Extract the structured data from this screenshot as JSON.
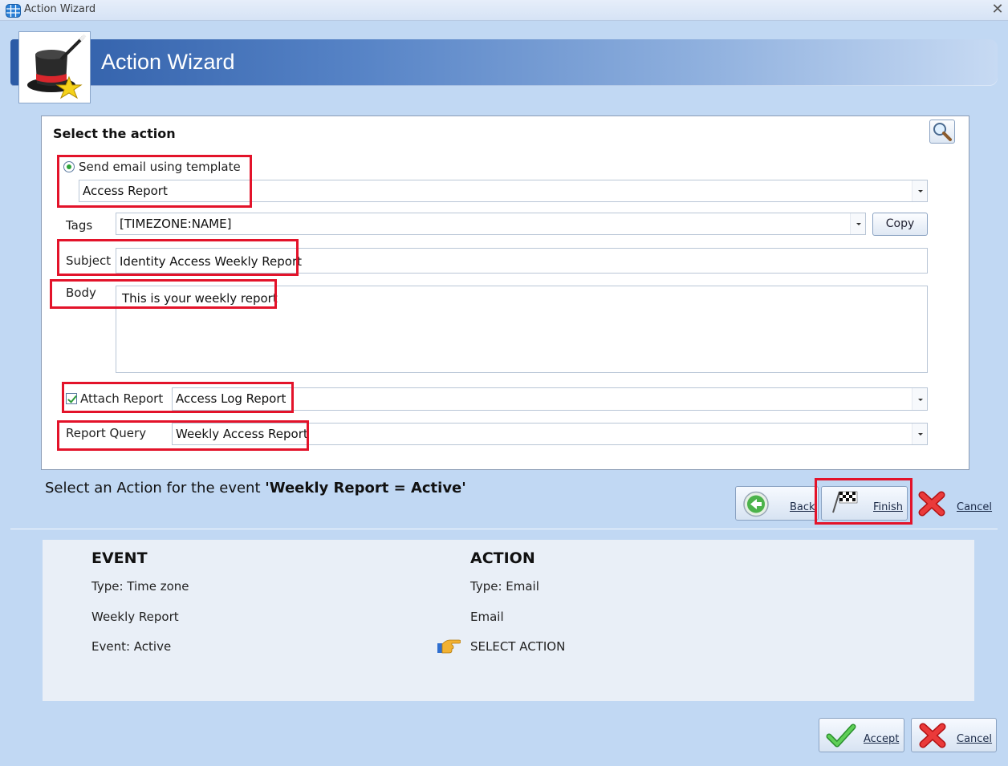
{
  "window": {
    "title": "Action Wizard"
  },
  "header": {
    "title": "Action Wizard"
  },
  "panel": {
    "title": "Select the action",
    "send_email": {
      "label": "Send email using template",
      "checked": true,
      "template": "Access Report"
    },
    "tags": {
      "label": "Tags",
      "value": "[TIMEZONE:NAME]",
      "copy_label": "Copy"
    },
    "subject": {
      "label": "Subject",
      "value": "Identity Access Weekly Report"
    },
    "body": {
      "label": "Body",
      "value": "This is your weekly report"
    },
    "attach_report": {
      "label": "Attach Report",
      "checked": true,
      "value": "Access Log Report"
    },
    "report_query": {
      "label": "Report Query",
      "value": "Weekly Access Report"
    }
  },
  "event_prompt": {
    "prefix": "Select an Action for the event",
    "event": "'Weekly Report = Active'"
  },
  "nav_buttons": {
    "back": "Back",
    "finish": "Finish",
    "cancel": "Cancel"
  },
  "summary": {
    "event": {
      "heading": "EVENT",
      "lines": [
        "Type: Time zone",
        "Weekly Report",
        "Event: Active"
      ]
    },
    "action": {
      "heading": "ACTION",
      "lines": [
        "Type: Email",
        "Email",
        "SELECT ACTION"
      ]
    }
  },
  "footer_buttons": {
    "accept": "Accept",
    "cancel": "Cancel"
  },
  "colors": {
    "highlight": "#e3132a",
    "banner": "#2c5ba6"
  }
}
